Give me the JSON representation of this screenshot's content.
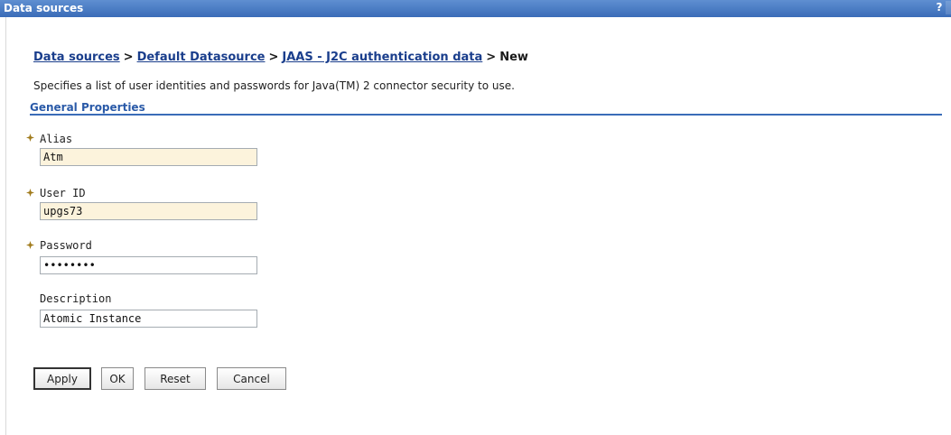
{
  "window": {
    "title": "Data sources",
    "help_label": "?"
  },
  "breadcrumb": {
    "items": [
      "Data sources",
      "Default Datasource",
      "JAAS - J2C authentication data"
    ],
    "separator": ">",
    "current": "New"
  },
  "description": "Specifies a list of user identities and passwords for Java(TM) 2 connector security to use.",
  "section": {
    "title": "General Properties"
  },
  "fields": [
    {
      "label": "Alias",
      "value": "Atm",
      "required": true
    },
    {
      "label": "User ID",
      "value": "upgs73",
      "required": true
    },
    {
      "label": "Password",
      "value": "••••••••",
      "required": true
    },
    {
      "label": "Description",
      "value": "Atomic Instance",
      "required": false
    }
  ],
  "buttons": {
    "apply": "Apply",
    "ok": "OK",
    "reset": "Reset",
    "cancel": "Cancel"
  },
  "colors": {
    "titlebar": "#3a6cb8",
    "link": "#1a3e8c",
    "section_header": "#2a5aa8",
    "required_field_bg": "#fcf3dc",
    "required_marker": "#a07a1a"
  }
}
